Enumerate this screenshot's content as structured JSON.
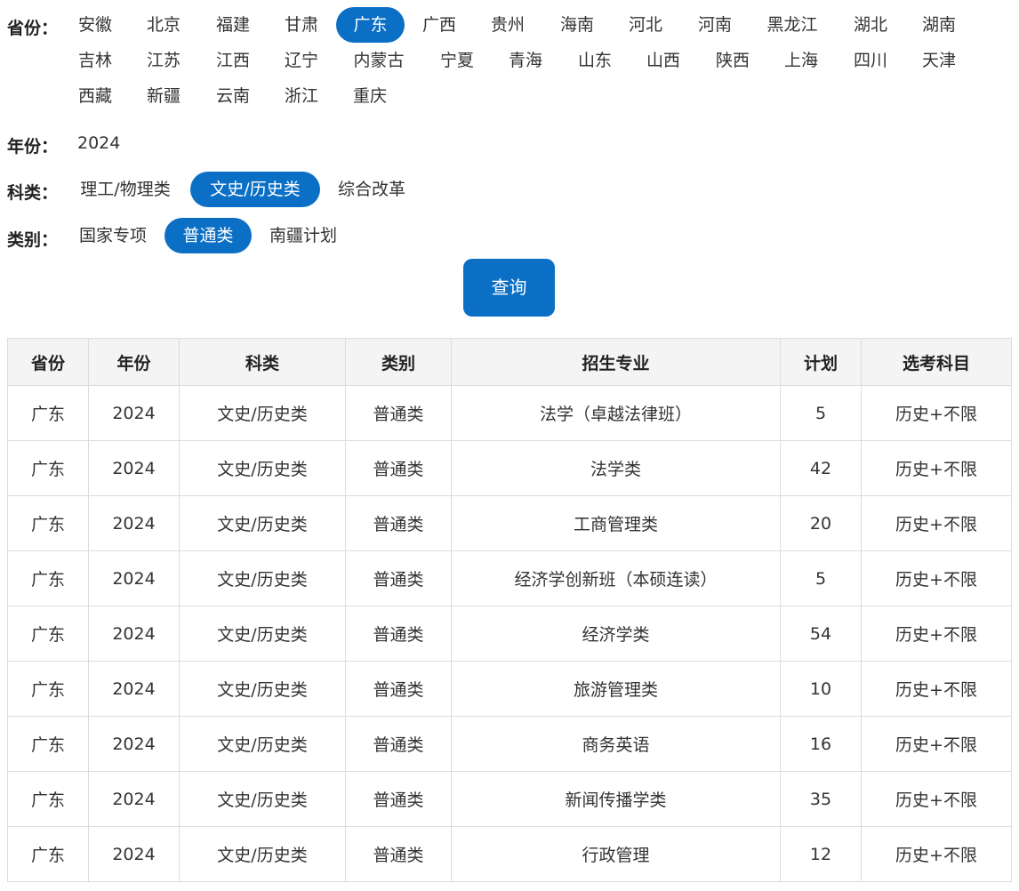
{
  "filters": {
    "province": {
      "label": "省份：",
      "options": [
        "安徽",
        "北京",
        "福建",
        "甘肃",
        "广东",
        "广西",
        "贵州",
        "海南",
        "河北",
        "河南",
        "黑龙江",
        "湖北",
        "湖南",
        "吉林",
        "江苏",
        "江西",
        "辽宁",
        "内蒙古",
        "宁夏",
        "青海",
        "山东",
        "山西",
        "陕西",
        "上海",
        "四川",
        "天津",
        "西藏",
        "新疆",
        "云南",
        "浙江",
        "重庆"
      ],
      "selected": "广东"
    },
    "year": {
      "label": "年份：",
      "value": "2024"
    },
    "subject": {
      "label": "科类：",
      "options": [
        "理工/物理类",
        "文史/历史类",
        "综合改革"
      ],
      "selected": "文史/历史类"
    },
    "category": {
      "label": "类别：",
      "options": [
        "国家专项",
        "普通类",
        "南疆计划"
      ],
      "selected": "普通类"
    }
  },
  "query_button": "查询",
  "accent_color": "#0b6fc6",
  "table": {
    "headers": [
      "省份",
      "年份",
      "科类",
      "类别",
      "招生专业",
      "计划",
      "选考科目"
    ],
    "rows": [
      [
        "广东",
        "2024",
        "文史/历史类",
        "普通类",
        "法学（卓越法律班）",
        "5",
        "历史+不限"
      ],
      [
        "广东",
        "2024",
        "文史/历史类",
        "普通类",
        "法学类",
        "42",
        "历史+不限"
      ],
      [
        "广东",
        "2024",
        "文史/历史类",
        "普通类",
        "工商管理类",
        "20",
        "历史+不限"
      ],
      [
        "广东",
        "2024",
        "文史/历史类",
        "普通类",
        "经济学创新班（本硕连读）",
        "5",
        "历史+不限"
      ],
      [
        "广东",
        "2024",
        "文史/历史类",
        "普通类",
        "经济学类",
        "54",
        "历史+不限"
      ],
      [
        "广东",
        "2024",
        "文史/历史类",
        "普通类",
        "旅游管理类",
        "10",
        "历史+不限"
      ],
      [
        "广东",
        "2024",
        "文史/历史类",
        "普通类",
        "商务英语",
        "16",
        "历史+不限"
      ],
      [
        "广东",
        "2024",
        "文史/历史类",
        "普通类",
        "新闻传播学类",
        "35",
        "历史+不限"
      ],
      [
        "广东",
        "2024",
        "文史/历史类",
        "普通类",
        "行政管理",
        "12",
        "历史+不限"
      ]
    ]
  }
}
